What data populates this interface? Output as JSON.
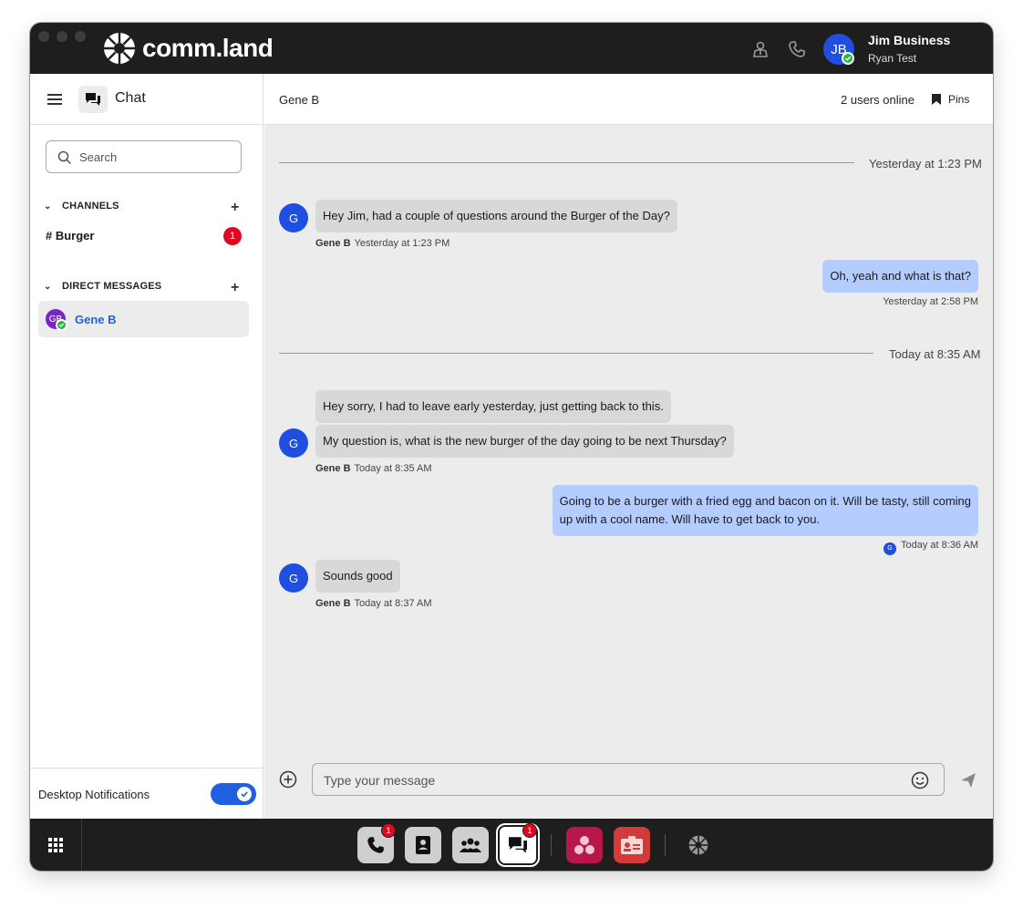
{
  "app": {
    "logo_text": "comm.land"
  },
  "user": {
    "initials": "JB",
    "name": "Jim Business",
    "subtitle": "Ryan Test"
  },
  "top_icons": [
    "contact-person-icon",
    "phone-icon"
  ],
  "sidebar": {
    "title": "Chat",
    "search_placeholder": "Search",
    "channels_label": "CHANNELS",
    "channels": [
      {
        "label": "# Burger",
        "unread": "1"
      }
    ],
    "dm_label": "DIRECT MESSAGES",
    "direct_messages": [
      {
        "initials": "GB",
        "name": "Gene B",
        "status": "online"
      }
    ],
    "notifications_label": "Desktop Notifications",
    "notifications_enabled": true
  },
  "chat": {
    "header_name": "Gene B",
    "online_count": "2 users online",
    "pins_label": "Pins",
    "dividers": [
      {
        "label": "Yesterday at 1:23 PM"
      },
      {
        "label": "Today at 8:35 AM"
      }
    ],
    "messages": [
      {
        "direction": "in",
        "avatar": "G",
        "text": "Hey Jim, had a couple of questions around the Burger of the Day?",
        "sender": "Gene B",
        "time": "Yesterday at 1:23 PM"
      },
      {
        "direction": "out",
        "text": "Oh, yeah and what is that?",
        "time": "Yesterday at 2:58 PM"
      },
      {
        "direction": "in",
        "text": "Hey sorry, I had to leave early yesterday, just getting back to this."
      },
      {
        "direction": "in",
        "avatar": "G",
        "text": "My question is, what is the new burger of the day going to be next Thursday?",
        "sender": "Gene B",
        "time": "Today at 8:35 AM"
      },
      {
        "direction": "out",
        "text_line1": "Going to be a burger with a fried egg and bacon on it. Will be tasty, still coming",
        "text_line2": "up with a cool name. Will have to get back to you.",
        "read_by": "G",
        "time": "Today at 8:36 AM"
      },
      {
        "direction": "in",
        "avatar": "G",
        "text": "Sounds good",
        "sender": "Gene B",
        "time": "Today at 8:37 AM"
      }
    ],
    "composer_placeholder": "Type your message"
  },
  "dock": {
    "apps": [
      {
        "name": "phone",
        "badge": "1"
      },
      {
        "name": "contacts"
      },
      {
        "name": "groups"
      },
      {
        "name": "chat",
        "badge": "1",
        "active": true
      },
      {
        "name": "app-red-1",
        "color": "#b8174a"
      },
      {
        "name": "app-red-2",
        "color": "#d33a3a"
      },
      {
        "name": "commland-logo"
      }
    ]
  },
  "colors": {
    "accent": "#1f4fe0",
    "outgoing_bubble": "#b5ccff",
    "incoming_bubble": "#d8d8d8",
    "unread_badge": "#e0081f",
    "online_status": "#2fb344"
  }
}
